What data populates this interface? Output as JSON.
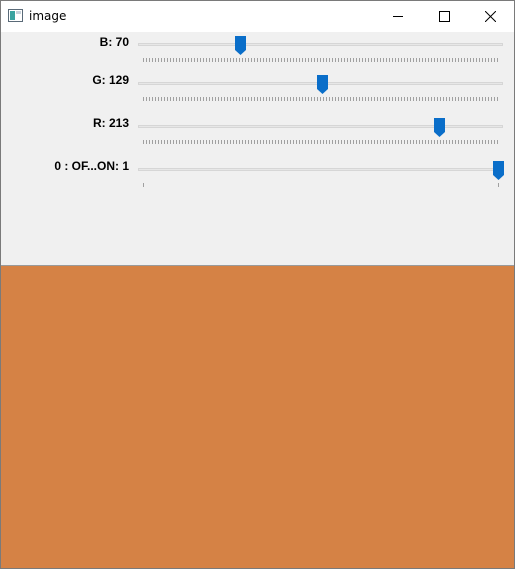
{
  "window": {
    "title": "image",
    "app_icon": "opencv-window-icon",
    "controls": [
      "minimize-icon",
      "maximize-icon",
      "close-icon"
    ]
  },
  "sliders": [
    {
      "id": "b",
      "label": "B: 70",
      "value": 70,
      "max": 255
    },
    {
      "id": "g",
      "label": "G: 129",
      "value": 129,
      "max": 255
    },
    {
      "id": "r",
      "label": "R: 213",
      "value": 213,
      "max": 255
    },
    {
      "id": "switch",
      "label": "0 : OF...ON: 1",
      "value": 1,
      "max": 1
    }
  ],
  "preview": {
    "color": "#d58245"
  },
  "colors": {
    "thumb": "#0a6ec9",
    "accent": "#0078d7"
  }
}
